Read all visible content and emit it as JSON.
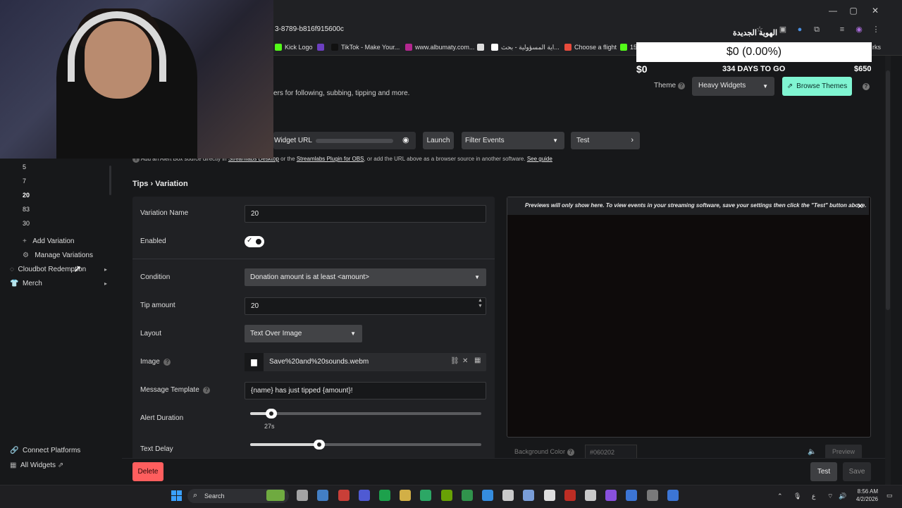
{
  "browser": {
    "url_fragment": "3-8789-b816f915600c",
    "profile_label_ar": "الهوية الجديدة",
    "bookmarks": [
      {
        "label": "Kick Logo",
        "color": "#53fc18"
      },
      {
        "label": "",
        "color": "#6c3fc0"
      },
      {
        "label": "TikTok - Make Your...",
        "color": "#111111"
      },
      {
        "label": "www.albumaty.com...",
        "color": "#b3278f"
      },
      {
        "label": "",
        "color": "#dddddd"
      },
      {
        "label": "اية المسؤولية - بحث...",
        "color": "#ffffff"
      },
      {
        "label": "Choose a flight",
        "color": "#e84b3c"
      },
      {
        "label": "15",
        "color": "#53fc18"
      }
    ],
    "bookmark_overflow": "rks"
  },
  "goal": {
    "progress_text": "$0 (0.00%)",
    "current": "$0",
    "days_left": "334 DAYS TO GO",
    "target": "$650"
  },
  "header": {
    "description": "ers for following, subbing, tipping and more.",
    "theme_label": "Theme",
    "theme_value": "Heavy Widgets",
    "browse_themes": "Browse Themes",
    "widget_url_label": "Widget URL",
    "launch_label": "Launch",
    "filter_events_label": "Filter Events",
    "test_label": "Test",
    "hint_prefix": "Add an Alert Box source directly in",
    "hint_link1": "Streamlabs Desktop",
    "hint_mid": "or the",
    "hint_link2": "Streamlabs Plugin for OBS",
    "hint_suffix": ", or add the URL above as a browser source in another software.",
    "hint_link3": "See guide"
  },
  "sidebar": {
    "variations": [
      "5",
      "7",
      "20",
      "83",
      "30"
    ],
    "active_variation": "20",
    "add_variation": "Add Variation",
    "manage_variations": "Manage Variations",
    "cloudbot": "Cloudbot Redemption",
    "merch": "Merch",
    "connect_platforms": "Connect Platforms",
    "all_widgets": "All Widgets"
  },
  "breadcrumb": {
    "parent": "Tips",
    "sep": "›",
    "current": "Variation"
  },
  "form": {
    "variation_name_label": "Variation Name",
    "variation_name": "20",
    "enabled_label": "Enabled",
    "enabled": true,
    "condition_label": "Condition",
    "condition_value": "Donation amount is at least <amount>",
    "tip_amount_label": "Tip amount",
    "tip_amount": "20",
    "layout_label": "Layout",
    "layout_value": "Text Over Image",
    "image_label": "Image",
    "image_file": "Save%20and%20sounds.webm",
    "message_template_label": "Message Template",
    "message_template": "{name} has just tipped {amount}!",
    "alert_duration_label": "Alert Duration",
    "alert_duration_value": "27s",
    "alert_duration_fraction": 0.09,
    "text_delay_label": "Text Delay",
    "text_delay_fraction": 0.3
  },
  "preview": {
    "note": "Previews will only show here. To view events in your streaming software, save your settings then click the \"Test\" button above.",
    "bg_color_label": "Background Color",
    "bg_color_value": "#060202",
    "preview_label": "Preview"
  },
  "footer": {
    "delete": "Delete",
    "test": "Test",
    "save": "Save"
  },
  "taskbar": {
    "search": "Search",
    "time": "8:56 AM",
    "date": "4/2/2026",
    "lang": "ع"
  },
  "colors": {
    "accent": "#80f5d2",
    "danger": "#ff5e5e",
    "panel": "#202124"
  }
}
